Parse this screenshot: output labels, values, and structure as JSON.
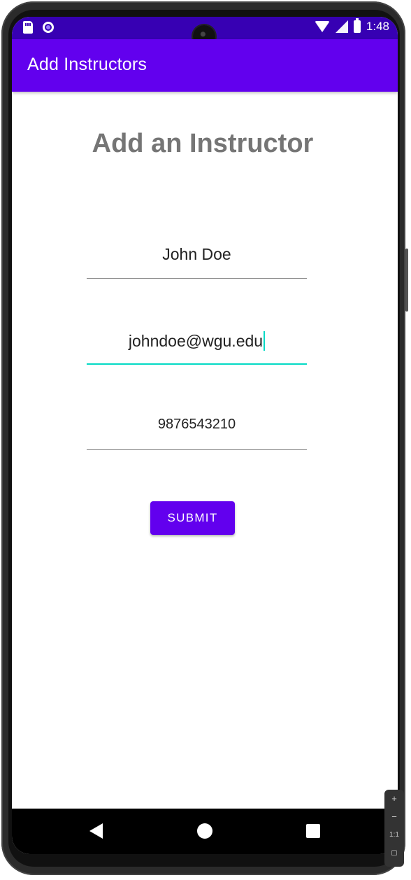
{
  "status_bar": {
    "time": "1:48",
    "left_icons": [
      "sd-card-icon",
      "circle-icon"
    ],
    "right_icons": [
      "wifi-icon",
      "signal-icon",
      "battery-icon"
    ]
  },
  "app_bar": {
    "title": "Add Instructors"
  },
  "form": {
    "heading": "Add an Instructor",
    "name_value": "John Doe",
    "email_value": "johndoe@wgu.edu",
    "phone_value": "9876543210",
    "submit_label": "SUBMIT"
  },
  "emulator_zoom": {
    "plus": "+",
    "minus": "−",
    "one_to_one": "1:1",
    "fit": "▢"
  },
  "colors": {
    "status_bar": "#3700b3",
    "app_bar": "#6200ee",
    "accent": "#03dac5",
    "heading_text": "#757575"
  }
}
